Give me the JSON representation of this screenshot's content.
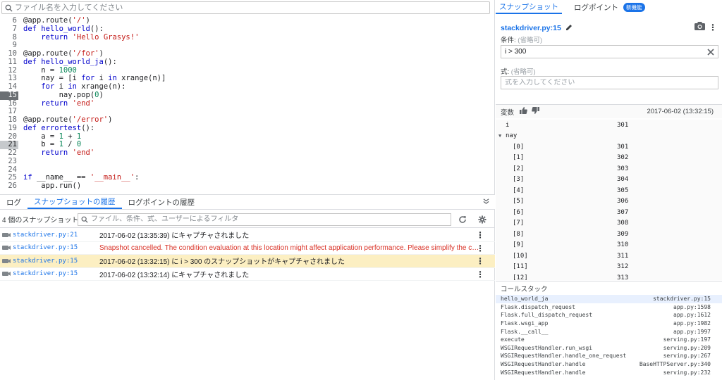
{
  "search": {
    "placeholder": "ファイル名を入力してください"
  },
  "code_lines": [
    {
      "n": "6",
      "parts": [
        [
          "",
          "@app.route("
        ],
        [
          "str",
          "'/'"
        ],
        [
          "",
          ")"
        ]
      ]
    },
    {
      "n": "7",
      "parts": [
        [
          "kw",
          "def "
        ],
        [
          "kw",
          "hello_world"
        ],
        [
          "",
          "():"
        ]
      ]
    },
    {
      "n": "8",
      "parts": [
        [
          "",
          "    "
        ],
        [
          "kw",
          "return "
        ],
        [
          "str",
          "'Hello Grasys!'"
        ]
      ]
    },
    {
      "n": "9",
      "parts": []
    },
    {
      "n": "10",
      "parts": [
        [
          "",
          "@app.route("
        ],
        [
          "str",
          "'/for'"
        ],
        [
          "",
          ")"
        ]
      ]
    },
    {
      "n": "11",
      "parts": [
        [
          "kw",
          "def "
        ],
        [
          "kw",
          "hello_world_ja"
        ],
        [
          "",
          "():"
        ]
      ]
    },
    {
      "n": "12",
      "parts": [
        [
          "",
          "    n = "
        ],
        [
          "num",
          "1000"
        ]
      ]
    },
    {
      "n": "13",
      "parts": [
        [
          "",
          "    nay = [i "
        ],
        [
          "kw",
          "for "
        ],
        [
          "",
          "i "
        ],
        [
          "kw",
          "in "
        ],
        [
          "",
          "xrange(n)]"
        ]
      ]
    },
    {
      "n": "14",
      "parts": [
        [
          "",
          "    "
        ],
        [
          "kw",
          "for "
        ],
        [
          "",
          "i "
        ],
        [
          "kw",
          "in "
        ],
        [
          "",
          "xrange(n):"
        ]
      ]
    },
    {
      "n": "15",
      "bp": "active",
      "badge": "3",
      "parts": [
        [
          "",
          "        nay.pop("
        ],
        [
          "num",
          "0"
        ],
        [
          "",
          ")"
        ]
      ]
    },
    {
      "n": "16",
      "parts": [
        [
          "",
          "    "
        ],
        [
          "kw",
          "return "
        ],
        [
          "str",
          "'end'"
        ]
      ]
    },
    {
      "n": "17",
      "parts": []
    },
    {
      "n": "18",
      "parts": [
        [
          "",
          "@app.route("
        ],
        [
          "str",
          "'/error'"
        ],
        [
          "",
          ")"
        ]
      ]
    },
    {
      "n": "19",
      "parts": [
        [
          "kw",
          "def "
        ],
        [
          "kw",
          "errortest"
        ],
        [
          "",
          "():"
        ]
      ]
    },
    {
      "n": "20",
      "parts": [
        [
          "",
          "    a = "
        ],
        [
          "num",
          "1"
        ],
        [
          "",
          " + "
        ],
        [
          "num",
          "1"
        ]
      ]
    },
    {
      "n": "21",
      "bp": "set",
      "parts": [
        [
          "",
          "    b = "
        ],
        [
          "num",
          "1"
        ],
        [
          "",
          " / "
        ],
        [
          "num",
          "0"
        ]
      ]
    },
    {
      "n": "22",
      "parts": [
        [
          "",
          "    "
        ],
        [
          "kw",
          "return "
        ],
        [
          "str",
          "'end'"
        ]
      ]
    },
    {
      "n": "23",
      "parts": []
    },
    {
      "n": "24",
      "parts": []
    },
    {
      "n": "25",
      "parts": [
        [
          "kw",
          "if "
        ],
        [
          "",
          "__name__ == "
        ],
        [
          "str",
          "'__main__'"
        ],
        [
          "",
          ":"
        ]
      ]
    },
    {
      "n": "26",
      "parts": [
        [
          "",
          "    app.run()"
        ]
      ]
    }
  ],
  "bottom_tabs": [
    {
      "label": "ログ",
      "active": false
    },
    {
      "label": "スナップショットの履歴",
      "active": true
    },
    {
      "label": "ログポイントの履歴",
      "active": false
    }
  ],
  "history": {
    "count_label": "4 個のスナップショット...",
    "filter_placeholder": "ファイル、条件、式、ユーザーによるフィルタ",
    "rows": [
      {
        "file": "stackdriver.py:21",
        "msg": "2017-06-02 (13:35:39) にキャプチャされました",
        "type": "normal"
      },
      {
        "file": "stackdriver.py:15",
        "msg": "Snapshot cancelled. The condition evaluation at this location might affect application performance. Please simplify the condition or move the snapshot to a different location.",
        "type": "error"
      },
      {
        "file": "stackdriver.py:15",
        "msg": "2017-06-02 (13:32:15) に i > 300 のスナップショットがキャプチャされました",
        "type": "selected"
      },
      {
        "file": "stackdriver.py:15",
        "msg": "2017-06-02 (13:32:14) にキャプチャされました",
        "type": "normal"
      }
    ]
  },
  "right_tabs": {
    "snapshot": "スナップショット",
    "logpoint": "ログポイント",
    "new_badge": "新機能"
  },
  "snapshot": {
    "title": "stackdriver.py:15",
    "condition_label": "条件:",
    "condition_optional": "(省略可)",
    "condition_value": "i > 300",
    "expression_label": "式:",
    "expression_optional": "(省略可)",
    "expression_placeholder": "式を入力してください"
  },
  "variables": {
    "label": "変数",
    "timestamp": "2017-06-02 (13:32:15)",
    "rows": [
      {
        "name": "i",
        "value": "301",
        "level": 0
      },
      {
        "name": "nay",
        "value": "",
        "level": 0,
        "expanded": true
      },
      {
        "name": "[0]",
        "value": "301",
        "level": 1
      },
      {
        "name": "[1]",
        "value": "302",
        "level": 1
      },
      {
        "name": "[2]",
        "value": "303",
        "level": 1
      },
      {
        "name": "[3]",
        "value": "304",
        "level": 1
      },
      {
        "name": "[4]",
        "value": "305",
        "level": 1
      },
      {
        "name": "[5]",
        "value": "306",
        "level": 1
      },
      {
        "name": "[6]",
        "value": "307",
        "level": 1
      },
      {
        "name": "[7]",
        "value": "308",
        "level": 1
      },
      {
        "name": "[8]",
        "value": "309",
        "level": 1
      },
      {
        "name": "[9]",
        "value": "310",
        "level": 1
      },
      {
        "name": "[10]",
        "value": "311",
        "level": 1
      },
      {
        "name": "[11]",
        "value": "312",
        "level": 1
      },
      {
        "name": "[12]",
        "value": "313",
        "level": 1
      }
    ]
  },
  "callstack": {
    "label": "コールスタック",
    "rows": [
      {
        "fn": "hello_world_ja",
        "loc": "stackdriver.py:15",
        "active": true
      },
      {
        "fn": "Flask.dispatch_request",
        "loc": "app.py:1598"
      },
      {
        "fn": "Flask.full_dispatch_request",
        "loc": "app.py:1612"
      },
      {
        "fn": "Flask.wsgi_app",
        "loc": "app.py:1982"
      },
      {
        "fn": "Flask.__call__",
        "loc": "app.py:1997"
      },
      {
        "fn": "execute",
        "loc": "serving.py:197"
      },
      {
        "fn": "WSGIRequestHandler.run_wsgi",
        "loc": "serving.py:209"
      },
      {
        "fn": "WSGIRequestHandler.handle_one_request",
        "loc": "serving.py:267"
      },
      {
        "fn": "WSGIRequestHandler.handle",
        "loc": "BaseHTTPServer.py:340"
      },
      {
        "fn": "WSGIRequestHandler.handle",
        "loc": "serving.py:232"
      }
    ]
  },
  "icons": {
    "search": "search-icon",
    "camera": "camera-icon",
    "edit": "pencil-icon",
    "more": "kebab-icon",
    "clear": "close-icon",
    "refresh": "refresh-icon",
    "settings": "gear-icon",
    "collapse": "chevron-down-icon"
  },
  "colors": {
    "accent": "#1a73e8",
    "error": "#d93025",
    "selected_row": "#fcefc2"
  }
}
